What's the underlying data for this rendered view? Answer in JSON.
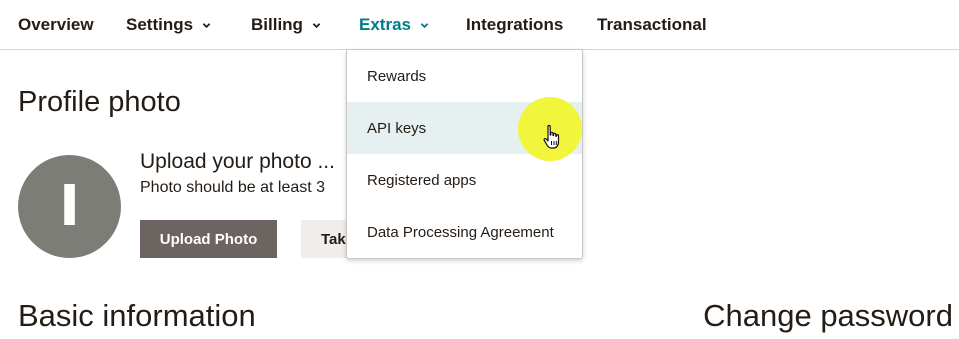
{
  "nav": {
    "items": [
      {
        "label": "Overview",
        "dropdown": false
      },
      {
        "label": "Settings",
        "dropdown": true
      },
      {
        "label": "Billing",
        "dropdown": true
      },
      {
        "label": "Extras",
        "dropdown": true,
        "active": true
      },
      {
        "label": "Integrations",
        "dropdown": false
      },
      {
        "label": "Transactional",
        "dropdown": false
      }
    ]
  },
  "profile": {
    "heading": "Profile photo",
    "avatar_letter": "I",
    "upload_title": "Upload your photo ...",
    "upload_hint": "Photo should be at least 3",
    "upload_button": "Upload Photo",
    "take_button": "Tak"
  },
  "extras_menu": {
    "items": [
      "Rewards",
      "API keys",
      "Registered apps",
      "Data Processing Agreement"
    ],
    "hovered": "API keys"
  },
  "sections": {
    "basic_info": "Basic information",
    "change_password": "Change password"
  },
  "colors": {
    "active_nav": "#007c89",
    "primary_button": "#6b6460",
    "hover_item": "#e6f0f1",
    "cursor_highlight": "#f1f432"
  },
  "icons": {
    "dropdown": "chevron-down-icon",
    "cursor": "hand-pointer-icon"
  }
}
